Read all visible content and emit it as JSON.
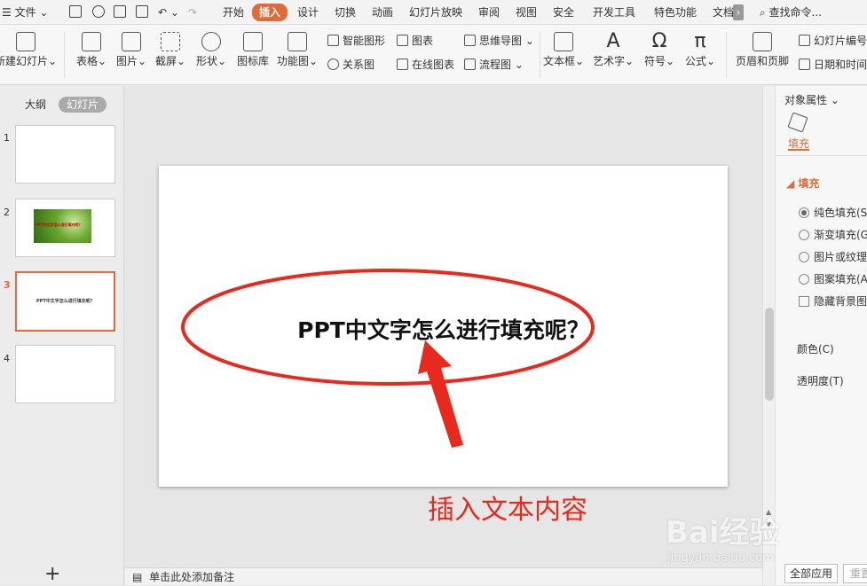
{
  "tabbar": {
    "menu_label": "文件",
    "tabs": [
      "开始",
      "插入",
      "设计",
      "切换",
      "动画",
      "幻灯片放映",
      "审阅",
      "视图",
      "安全",
      "开发工具",
      "特色功能",
      "文档"
    ],
    "search_label": "查找命令..."
  },
  "ribbon": {
    "new_slide": "新建幻灯片",
    "table": "表格",
    "picture": "图片",
    "screenshot": "截屏",
    "shape": "形状",
    "icon_lib": "图标库",
    "func_chart": "功能图",
    "smart_shape": "智能图形",
    "chart": "图表",
    "relation_chart": "关系图",
    "online_chart": "在线图表",
    "mindmap": "思维导图",
    "flowchart": "流程图",
    "textbox": "文本框",
    "wordart": "艺术字",
    "symbol": "符号",
    "formula": "公式",
    "header_footer": "页眉和页脚",
    "slide_number": "幻灯片编号",
    "date_time": "日期和时间"
  },
  "left_panel": {
    "outline_tab": "大纲",
    "slides_tab": "幻灯片",
    "slides": [
      {
        "number": "1",
        "text": ""
      },
      {
        "number": "2",
        "text": "PPT中文字怎么进行填充呢？"
      },
      {
        "number": "3",
        "text": "PPT中文字怎么进行填充呢？"
      },
      {
        "number": "4",
        "text": ""
      }
    ],
    "add_symbol": "+"
  },
  "slide": {
    "title": "PPT中文字怎么进行填充呢？",
    "annotation": "插入文本内容"
  },
  "notes": {
    "placeholder": "单击此处添加备注"
  },
  "right_pane": {
    "title": "对象属性",
    "fill_tab": "填充",
    "section": "填充",
    "options": [
      "纯色填充(S)",
      "渐变填充(G)",
      "图片或纹理",
      "图案填充(A)"
    ],
    "hide_bg": "隐藏背景图",
    "color_label": "颜色(C)",
    "transparency_label": "透明度(T)",
    "apply_all": "全部应用",
    "reset": "重置"
  },
  "watermark": {
    "brand": "Bai经验",
    "url": "jingyan.baidu.com"
  },
  "colors": {
    "accent": "#e06a39",
    "annotation_red": "#e8291c"
  }
}
